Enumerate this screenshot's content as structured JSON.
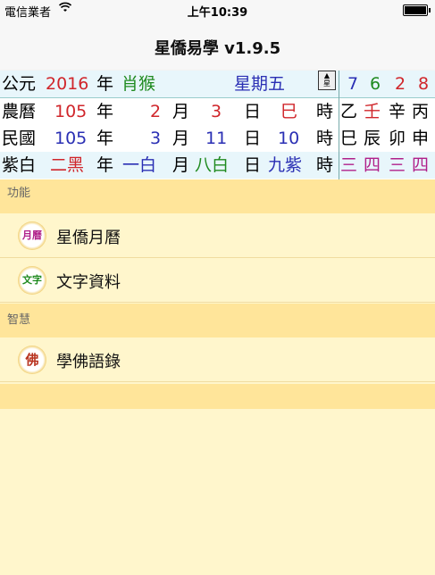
{
  "status": {
    "carrier": "電信業者",
    "time": "上午10:39"
  },
  "nav": {
    "title": "星僑易學 v1.9.5"
  },
  "calendar": {
    "row0": {
      "label": "公元",
      "year": "2016",
      "unit": "年",
      "zodiac": "肖猴",
      "weekday": "星期五",
      "nums": [
        "7",
        "6",
        "2",
        "8"
      ]
    },
    "row1": {
      "label": "農曆",
      "year": "105",
      "y": "年",
      "month": "2",
      "m": "月",
      "day": "3",
      "d": "日",
      "hour": "巳",
      "h": "時",
      "stems": [
        "乙",
        "壬",
        "辛",
        "丙"
      ]
    },
    "row2": {
      "label": "民國",
      "year": "105",
      "y": "年",
      "month": "3",
      "m": "月",
      "day": "11",
      "d": "日",
      "hour": "10",
      "h": "時",
      "branches": [
        "巳",
        "辰",
        "卯",
        "申"
      ]
    },
    "row3": {
      "label": "紫白",
      "a": "二黑",
      "y": "年",
      "b": "一白",
      "m": "月",
      "c": "八白",
      "d": "日",
      "e": "九紫",
      "h": "時",
      "stars": [
        "三",
        "四",
        "三",
        "四"
      ]
    }
  },
  "sections": [
    {
      "header": "功能",
      "items": [
        {
          "icon": "月曆",
          "label": "星僑月曆"
        },
        {
          "icon": "文字",
          "label": "文字資料"
        }
      ]
    },
    {
      "header": "智慧",
      "items": [
        {
          "icon": "佛",
          "label": "學佛語錄"
        }
      ]
    }
  ]
}
